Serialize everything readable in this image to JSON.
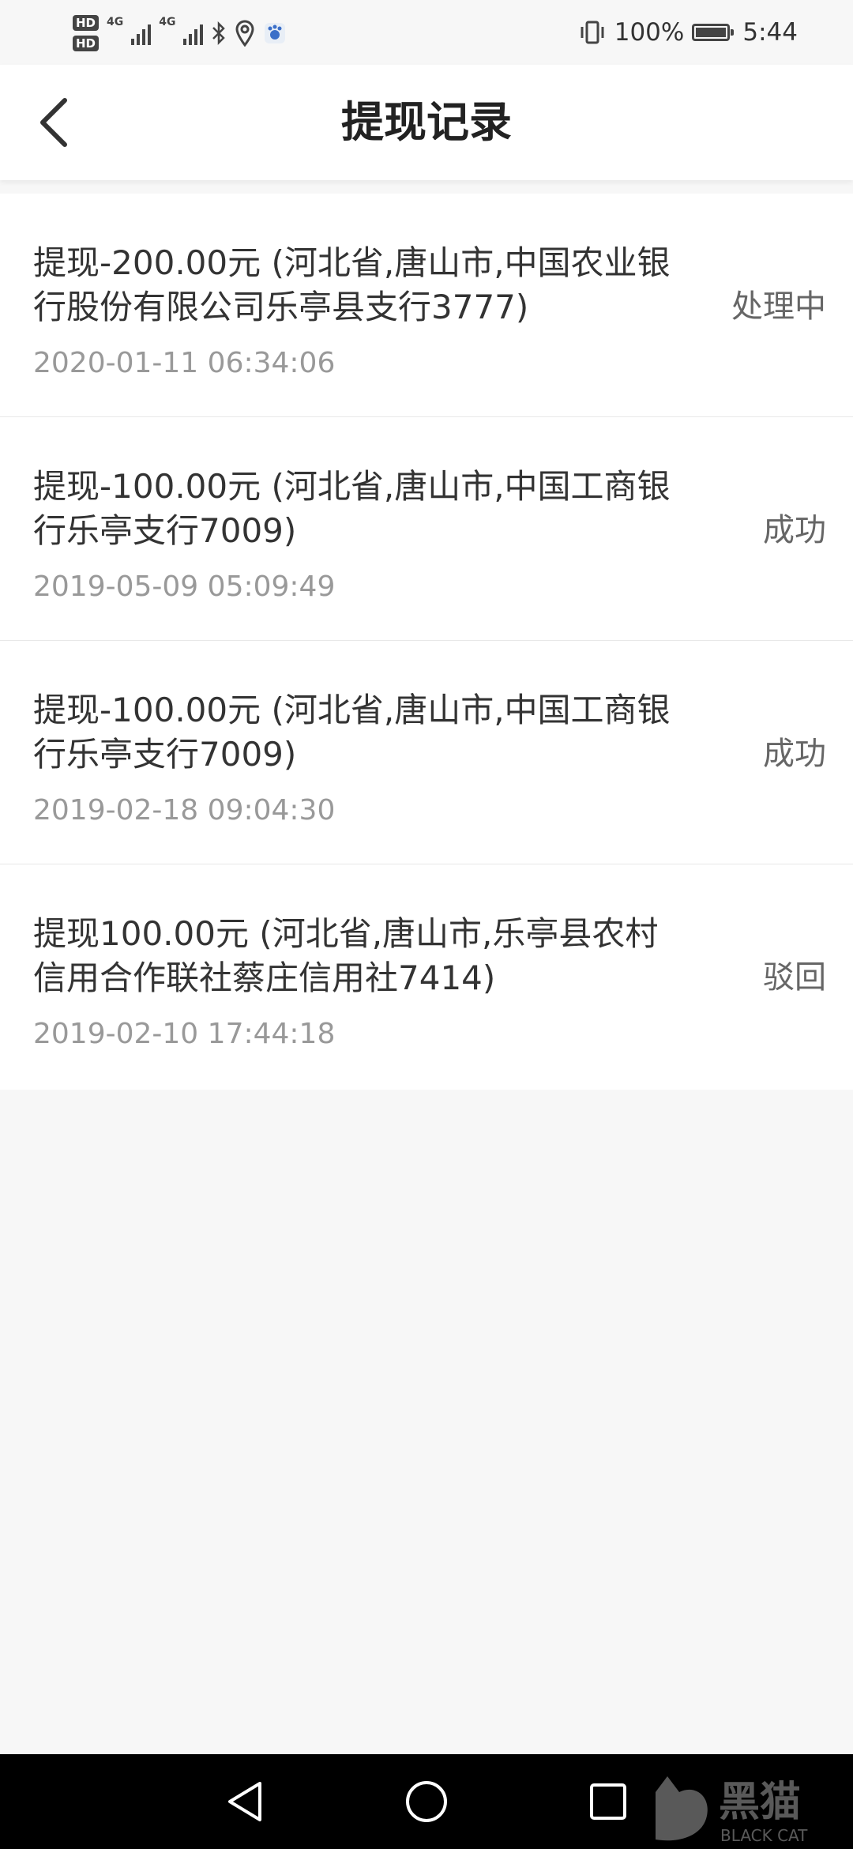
{
  "status_bar": {
    "hd1": "HD",
    "hd2": "HD",
    "net1": "4G",
    "net2": "4G",
    "battery_percent": "100%",
    "battery_level": 1.0,
    "time": "5:44"
  },
  "header": {
    "title": "提现记录"
  },
  "records": [
    {
      "description": "提现-200.00元 (河北省,唐山市,中国农业银行股份有限公司乐亭县支行3777)",
      "datetime": "2020-01-11 06:34:06",
      "status": "处理中"
    },
    {
      "description": "提现-100.00元 (河北省,唐山市,中国工商银行乐亭支行7009)",
      "datetime": "2019-05-09 05:09:49",
      "status": "成功"
    },
    {
      "description": "提现-100.00元 (河北省,唐山市,中国工商银行乐亭支行7009)",
      "datetime": "2019-02-18 09:04:30",
      "status": "成功"
    },
    {
      "description": "提现100.00元 (河北省,唐山市,乐亭县农村信用合作联社蔡庄信用社7414)",
      "datetime": "2019-02-10 17:44:18",
      "status": "驳回"
    }
  ],
  "watermark": {
    "text": "黑猫",
    "subtext": "BLACK CAT"
  }
}
